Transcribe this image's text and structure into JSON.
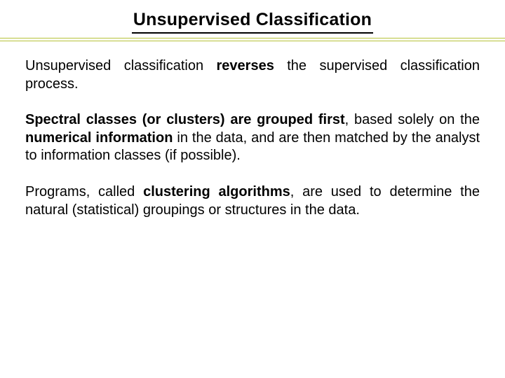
{
  "title": "Unsupervised Classification",
  "para1": {
    "t1": "Unsupervised classification ",
    "b1": "reverses",
    "t2": " the supervised classification process."
  },
  "para2": {
    "b1": "Spectral classes (or clusters) are grouped first",
    "t1": ", based solely on the ",
    "b2": "numerical information",
    "t2": " in the data, and are then matched by the analyst to information classes (if possible)."
  },
  "para3": {
    "t1": "Programs, called ",
    "b1": "clustering algorithms",
    "t2": ", are used to determine the natural (statistical) groupings or structures in the data."
  }
}
